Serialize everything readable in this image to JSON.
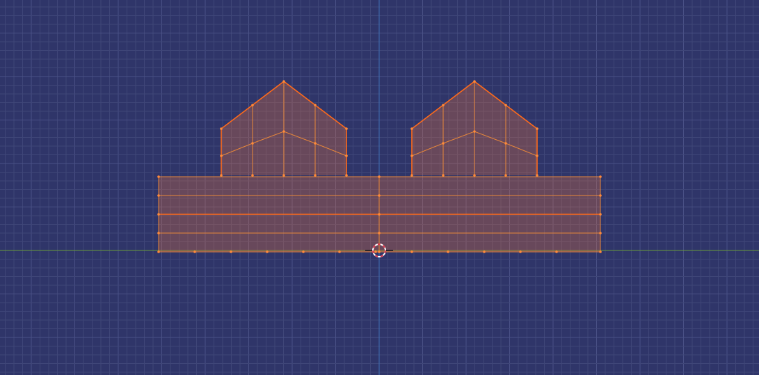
{
  "viewport": {
    "view": "front-orthographic",
    "mode": "edit-mode",
    "selection": "all-selected"
  },
  "colors": {
    "background": "#2f3569",
    "grid_minor": "#3f4678",
    "grid_major": "#4a5186",
    "x_axis": "#6a9a3a",
    "z_axis": "#3f6fb2",
    "face_fill": "#ff7a3a",
    "edge": "#e8873a",
    "edge_active": "#ff6a1a",
    "vertex": "#ff8a3a",
    "cursor_ring_red": "#e0364a",
    "cursor_ring_white": "#ffffff"
  },
  "icons": {
    "cursor": "3d-cursor-icon"
  },
  "mesh": {
    "objects": [
      "base-slab",
      "left-gable-block",
      "right-gable-block"
    ]
  }
}
